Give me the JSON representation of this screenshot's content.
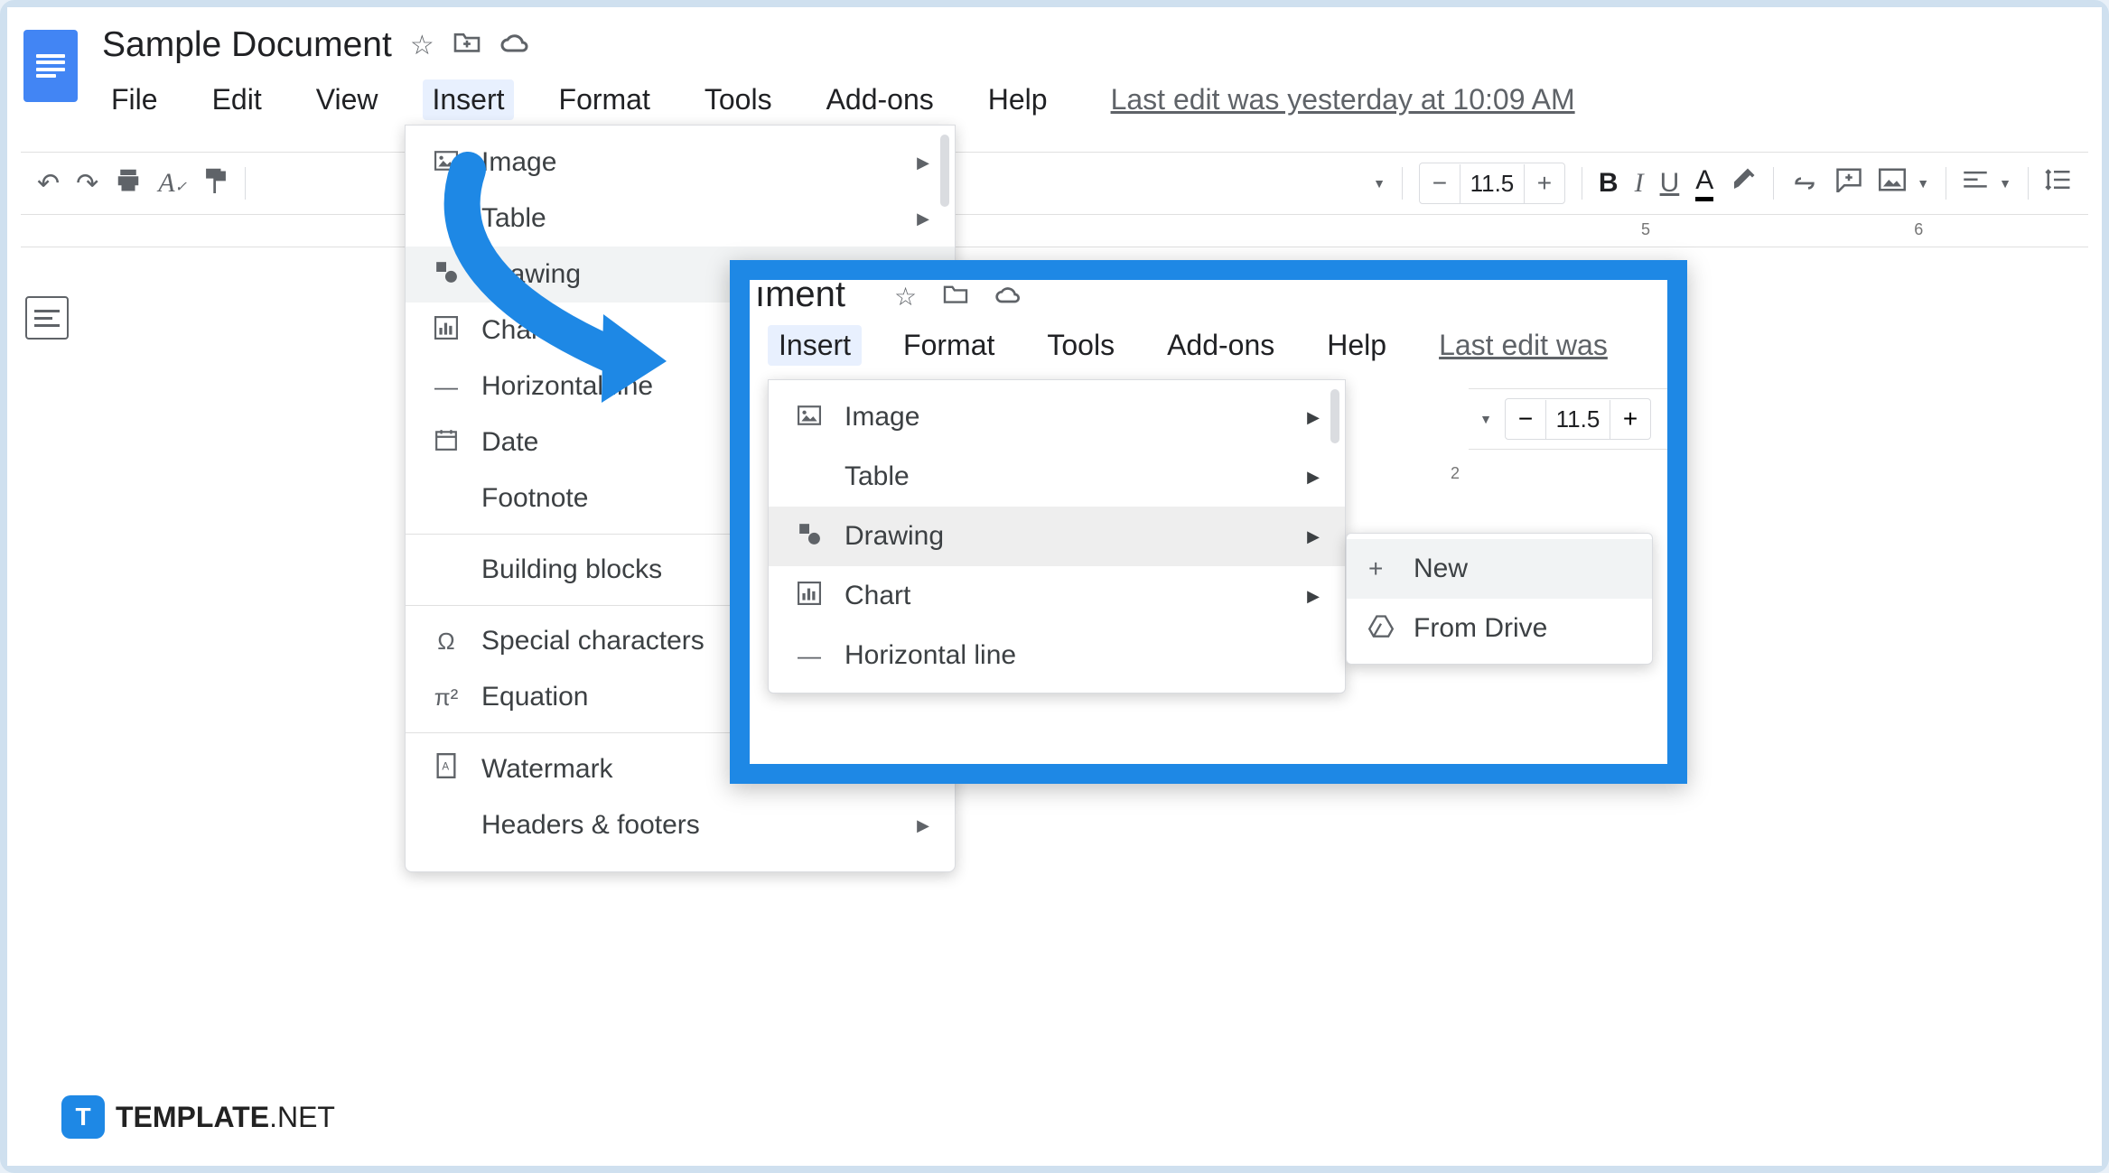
{
  "doc_title": "Sample Document",
  "menubar": {
    "file": "File",
    "edit": "Edit",
    "view": "View",
    "insert": "Insert",
    "format": "Format",
    "tools": "Tools",
    "addons": "Add-ons",
    "help": "Help",
    "last_edit": "Last edit was yesterday at 10:09 AM"
  },
  "toolbar": {
    "font_size": "11.5"
  },
  "insert_menu": {
    "image": "Image",
    "table": "Table",
    "drawing": "Drawing",
    "chart": "Chart",
    "hline": "Horizontal line",
    "date": "Date",
    "footnote": "Footnote",
    "building_blocks": "Building blocks",
    "special_chars": "Special characters",
    "equation": "Equation",
    "watermark": "Watermark",
    "headers_footers": "Headers & footers"
  },
  "callout": {
    "title_fragment": "ıment",
    "menubar": {
      "insert": "Insert",
      "format": "Format",
      "tools": "Tools",
      "addons": "Add-ons",
      "help": "Help",
      "last_edit": "Last edit was"
    },
    "font_size": "11.5",
    "ruler_num": "2",
    "insert_items": {
      "image": "Image",
      "table": "Table",
      "drawing": "Drawing",
      "chart": "Chart",
      "hline": "Horizontal line"
    },
    "submenu": {
      "new": "New",
      "from_drive": "From Drive"
    }
  },
  "ruler": {
    "n5": "5",
    "n6": "6"
  },
  "watermark": {
    "badge": "T",
    "bold": "TEMPLATE",
    "rest": ".NET"
  }
}
